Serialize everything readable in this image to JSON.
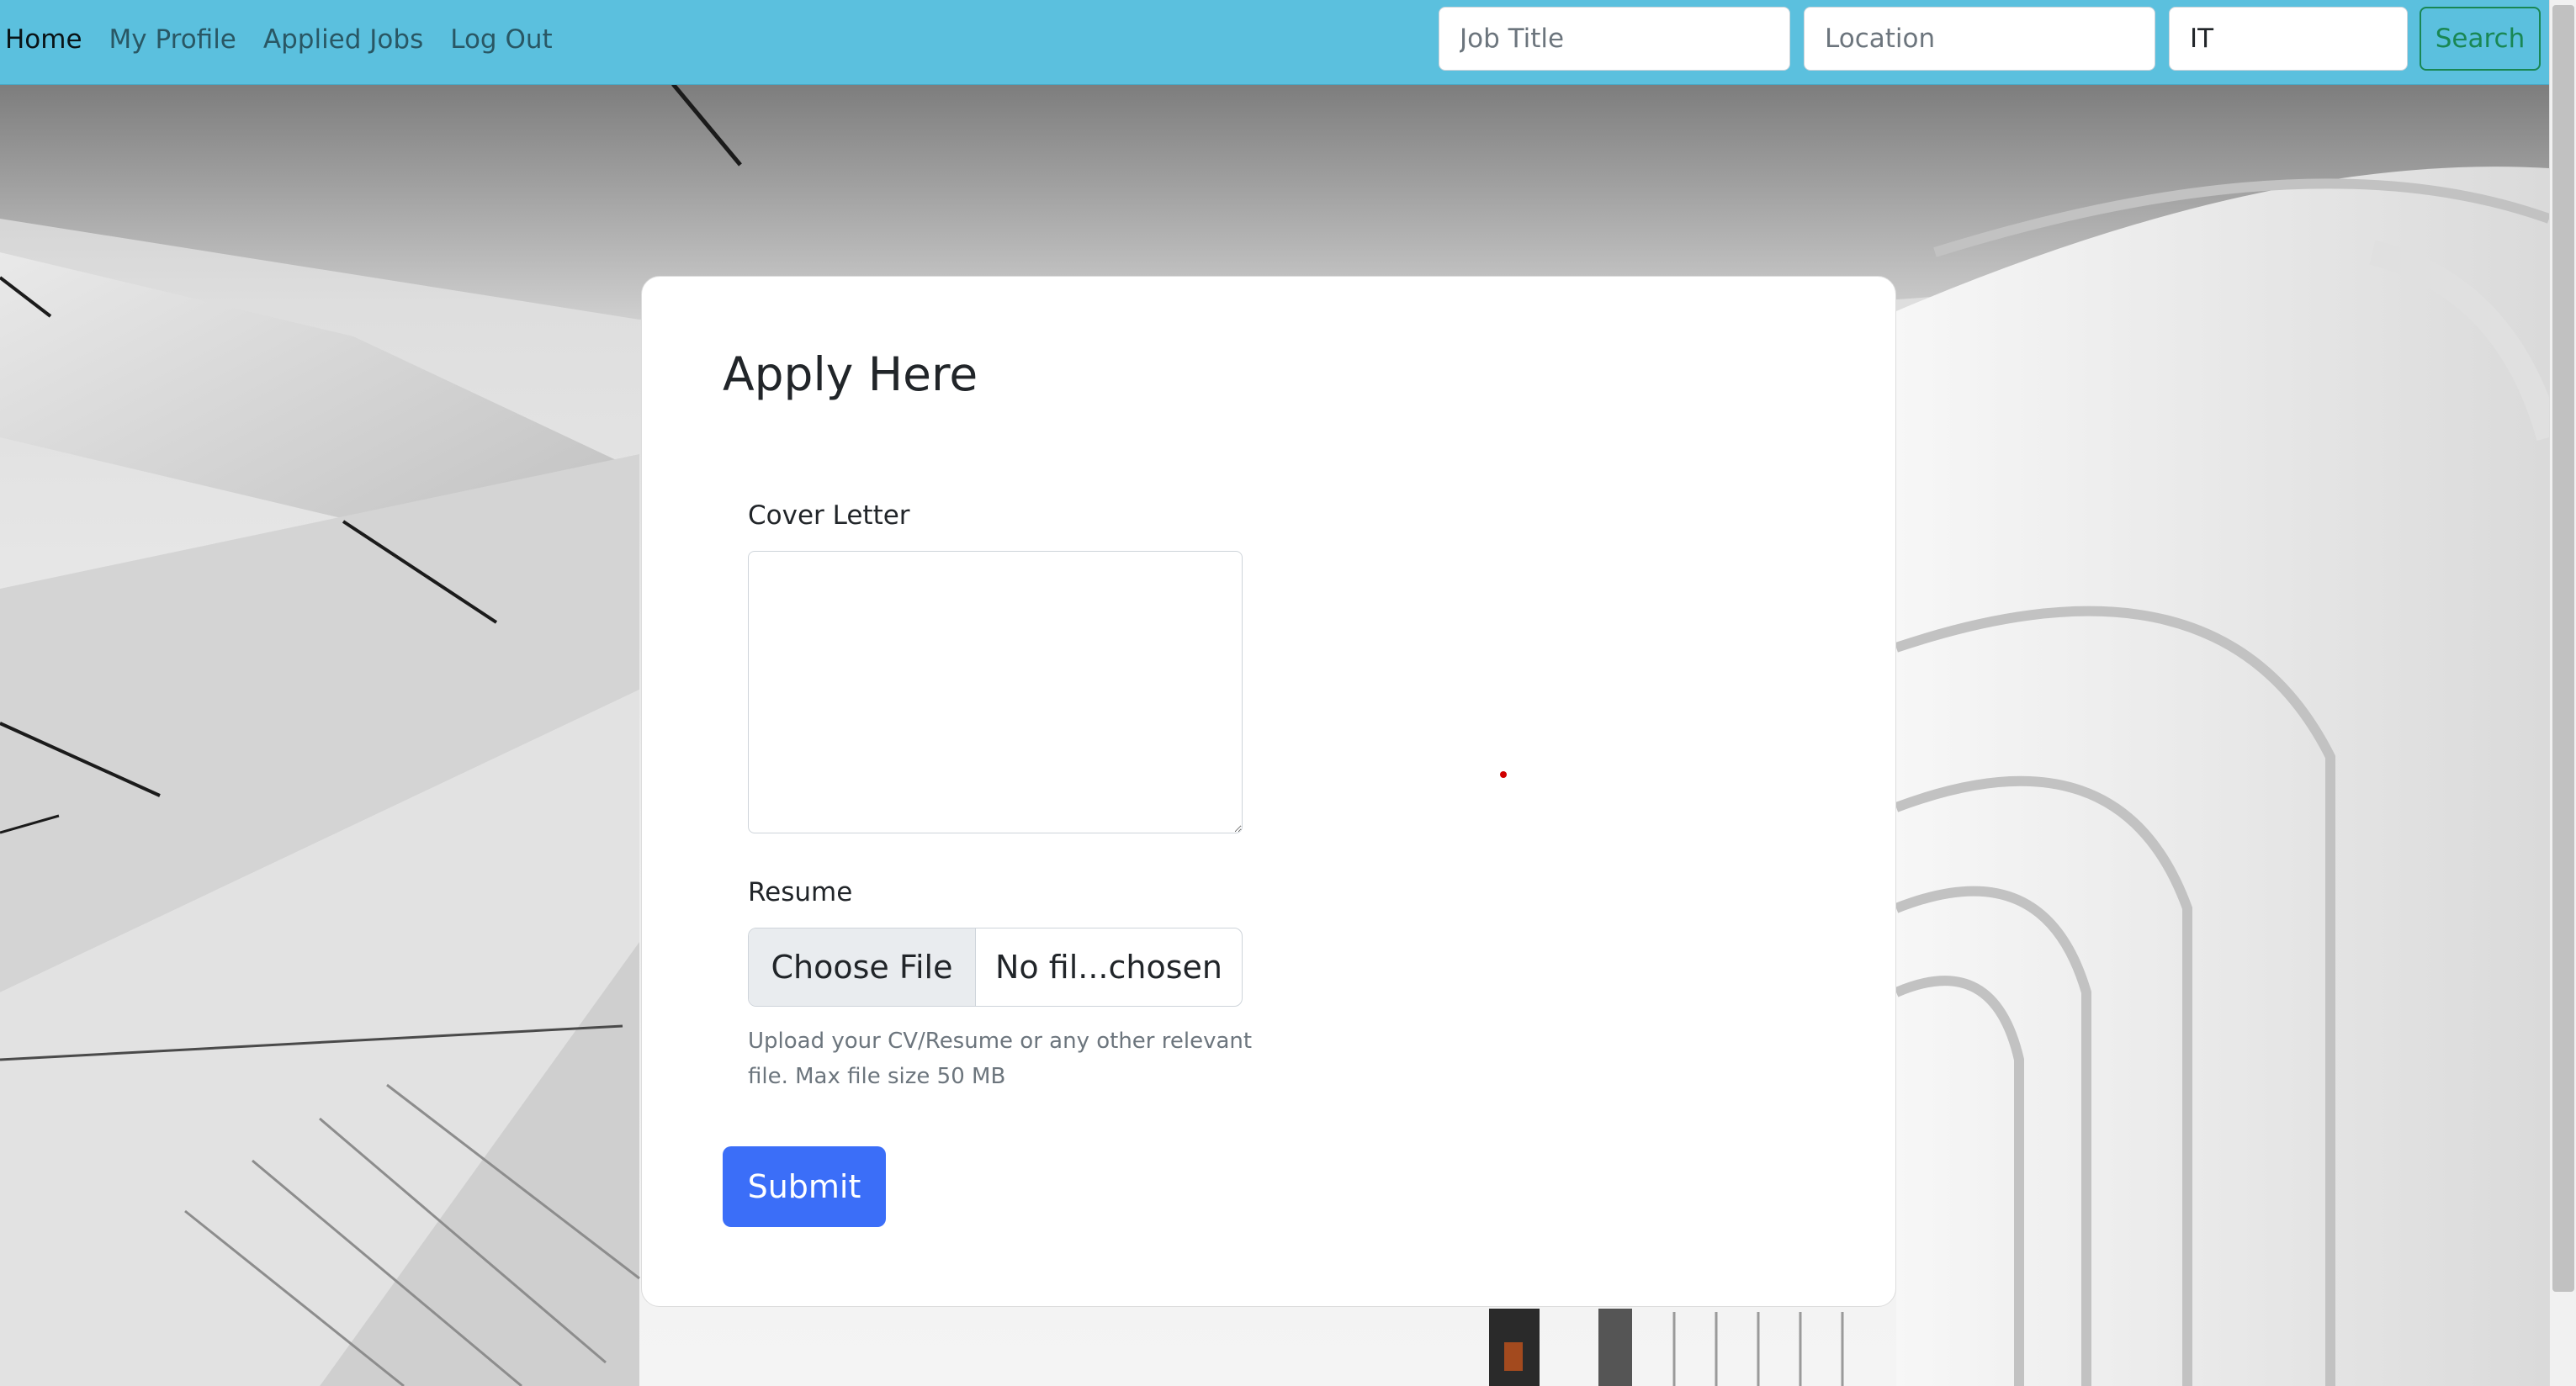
{
  "navbar": {
    "links": [
      "Home",
      "My Profile",
      "Applied Jobs",
      "Log Out"
    ],
    "search": {
      "job_title_placeholder": "Job Title",
      "location_placeholder": "Location",
      "category_value": "IT",
      "button_label": "Search"
    }
  },
  "form": {
    "title": "Apply Here",
    "cover_letter_label": "Cover Letter",
    "cover_letter_value": "",
    "resume_label": "Resume",
    "file_button_label": "Choose File",
    "file_status": "No fil...chosen",
    "help_text": "Upload your CV/Resume or any other relevant file. Max file size 50 MB",
    "submit_label": "Submit"
  },
  "colors": {
    "navbar": "#5bc0de",
    "primary": "#3b6ef8",
    "search_outline": "#198754"
  }
}
